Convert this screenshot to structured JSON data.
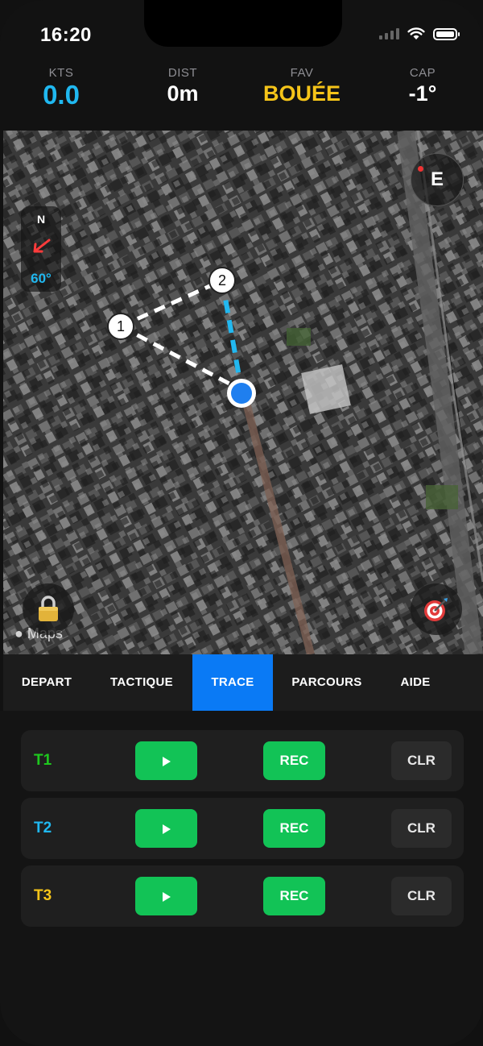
{
  "status_bar": {
    "time": "16:20"
  },
  "stats": [
    {
      "label": "KTS",
      "value": "0.0"
    },
    {
      "label": "DIST",
      "value": "0m"
    },
    {
      "label": "FAV",
      "value": "BOUÉE"
    },
    {
      "label": "CAP",
      "value": "-1°"
    }
  ],
  "map": {
    "attribution": "Maps",
    "compass_letter": "E",
    "heading_box": {
      "north": "N",
      "degrees": "60°"
    },
    "waypoints": [
      "1",
      "2"
    ],
    "lock_icon": "lock-icon",
    "target_icon": "dartboard-icon"
  },
  "tabs": [
    {
      "label": "DEPART"
    },
    {
      "label": "TACTIQUE"
    },
    {
      "label": "TRACE",
      "active": true
    },
    {
      "label": "PARCOURS"
    },
    {
      "label": "AIDE"
    }
  ],
  "tracks": [
    {
      "name": "T1",
      "color": "#1ec81e",
      "rec_label": "REC",
      "clr_label": "CLR"
    },
    {
      "name": "T2",
      "color": "#20b8f0",
      "rec_label": "REC",
      "clr_label": "CLR"
    },
    {
      "name": "T3",
      "color": "#f5c419",
      "rec_label": "REC",
      "clr_label": "CLR"
    }
  ],
  "colors": {
    "accent_blue": "#0a7af5",
    "speed_cyan": "#20b8f0",
    "fav_yellow": "#f5c419",
    "button_green": "#12c356"
  }
}
